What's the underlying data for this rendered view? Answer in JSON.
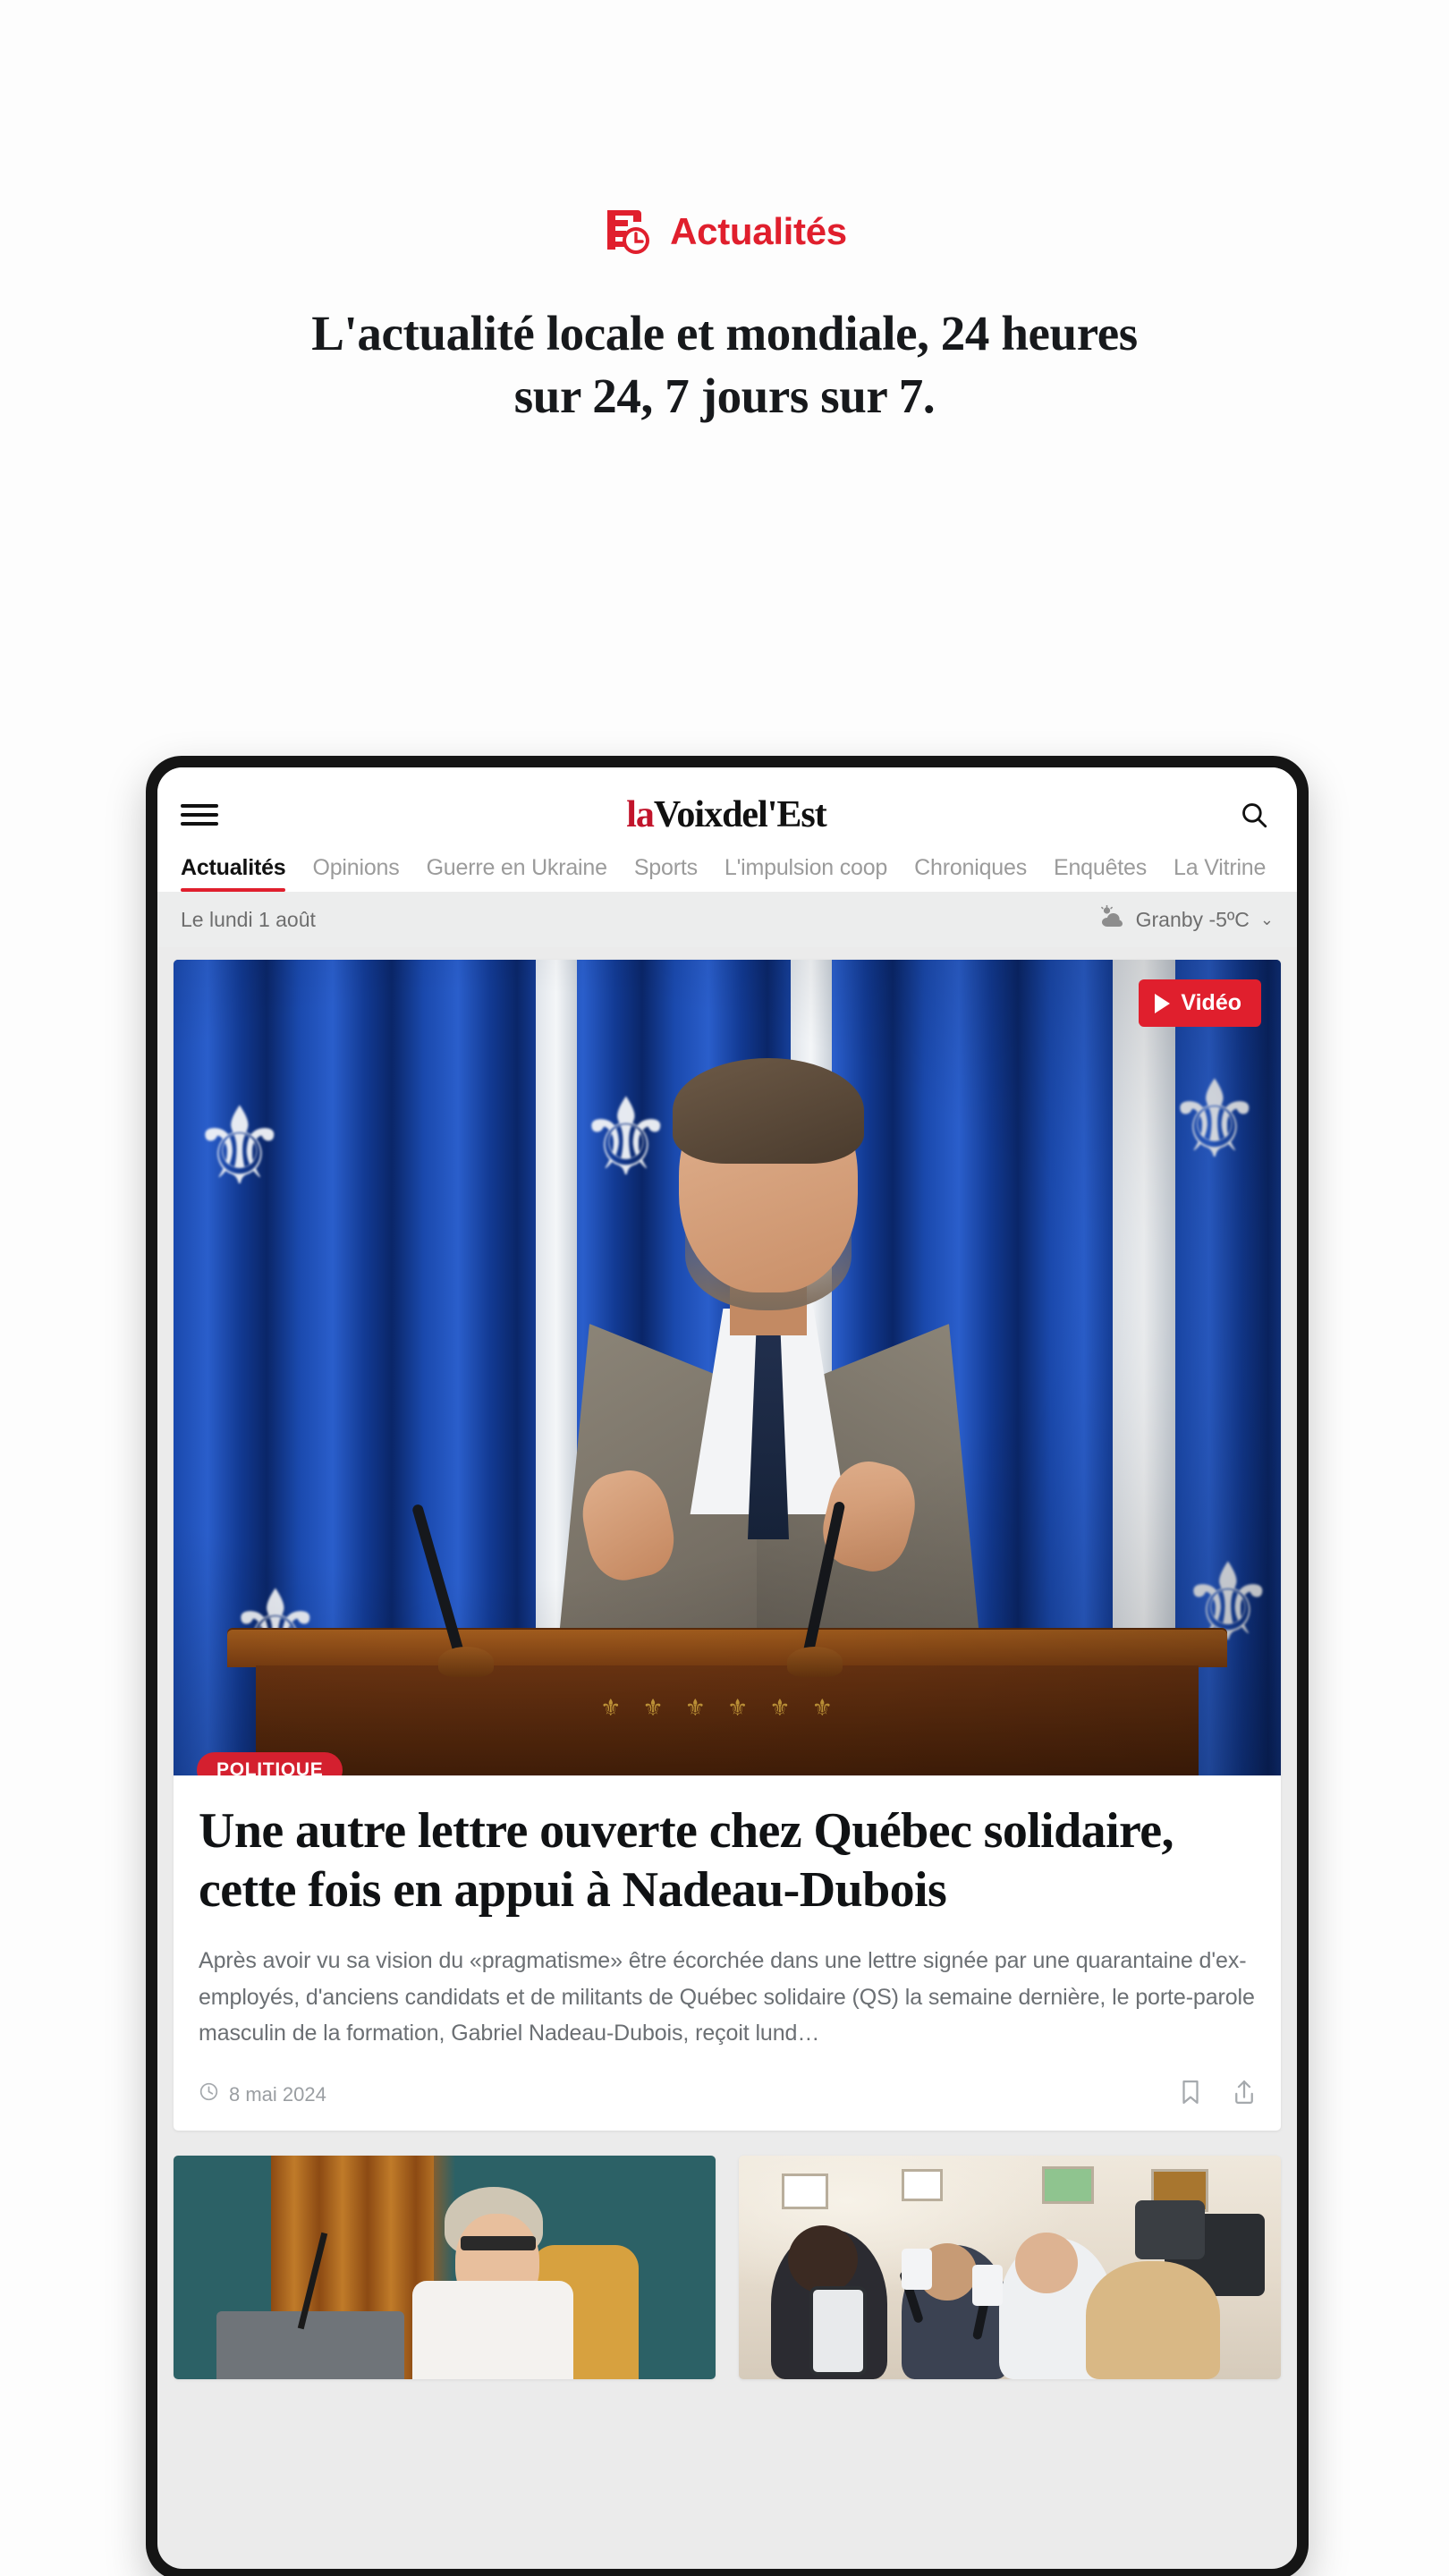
{
  "promo": {
    "icon": "news-clock-icon",
    "kicker": "Actualités",
    "title": "L'actualité locale et mondiale, 24 heures sur 24, 7 jours sur 7.",
    "accent_color": "#e01f2d"
  },
  "app": {
    "menu_icon": "hamburger-icon",
    "search_icon": "search-icon",
    "masthead": {
      "prefix": "la",
      "rest": "Voixdel'Est",
      "prefix_color": "#c1142b"
    },
    "tabs": [
      {
        "label": "Actualités",
        "active": true
      },
      {
        "label": "Opinions",
        "active": false
      },
      {
        "label": "Guerre en Ukraine",
        "active": false
      },
      {
        "label": "Sports",
        "active": false
      },
      {
        "label": "L'impulsion coop",
        "active": false
      },
      {
        "label": "Chroniques",
        "active": false
      },
      {
        "label": "Enquêtes",
        "active": false
      },
      {
        "label": "La Vitrine",
        "active": false
      }
    ],
    "strip": {
      "date": "Le lundi 1 août",
      "weather_icon": "cloud-sun-icon",
      "weather": "Granby -5ºC",
      "chevron": "⌄"
    },
    "hero": {
      "video_badge": "Vidéo",
      "play_icon": "play-icon",
      "category": "POLITIQUE",
      "category_color": "#d4202f",
      "title": "Une autre lettre ouverte chez Québec solidaire, cette fois en appui à Nadeau-Dubois",
      "summary": "Après avoir vu sa vision du «pragmatisme» être écorchée dans une lettre signée par une quarantaine d'ex-employés, d'anciens candidats et de militants de Québec solidaire (QS) la semaine dernière, le porte-parole masculin de la formation, Gabriel Nadeau-Dubois, reçoit lund…",
      "clock_icon": "clock-icon",
      "date": "8 mai 2024",
      "bookmark_icon": "bookmark-icon",
      "share_icon": "share-icon"
    },
    "cards": [
      {
        "name": "card-council-chamber"
      },
      {
        "name": "card-press-scrum"
      }
    ]
  }
}
